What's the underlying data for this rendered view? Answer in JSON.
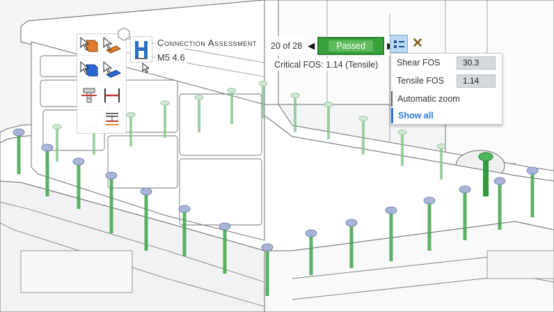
{
  "toolbar": {
    "title": "Connection Assessment",
    "subtitle": "M5 4.6",
    "counter": "20 of 28",
    "status": "Passed",
    "critical_fos": "Critical FOS: 1.14 (Tensile)"
  },
  "icons": {
    "prev": "◀",
    "next": "▶",
    "close": "✕"
  },
  "panel": {
    "shear_label": "Shear FOS",
    "shear_value": "30.3",
    "tensile_label": "Tensile FOS",
    "tensile_value": "1.14",
    "auto_zoom": "Automatic zoom",
    "show_all": "Show all"
  },
  "colors": {
    "status_green": "#38a33a",
    "bolt_green": "#3fa54a",
    "accent_blue": "#2a7ad5",
    "close_orange": "#7a5a10"
  }
}
